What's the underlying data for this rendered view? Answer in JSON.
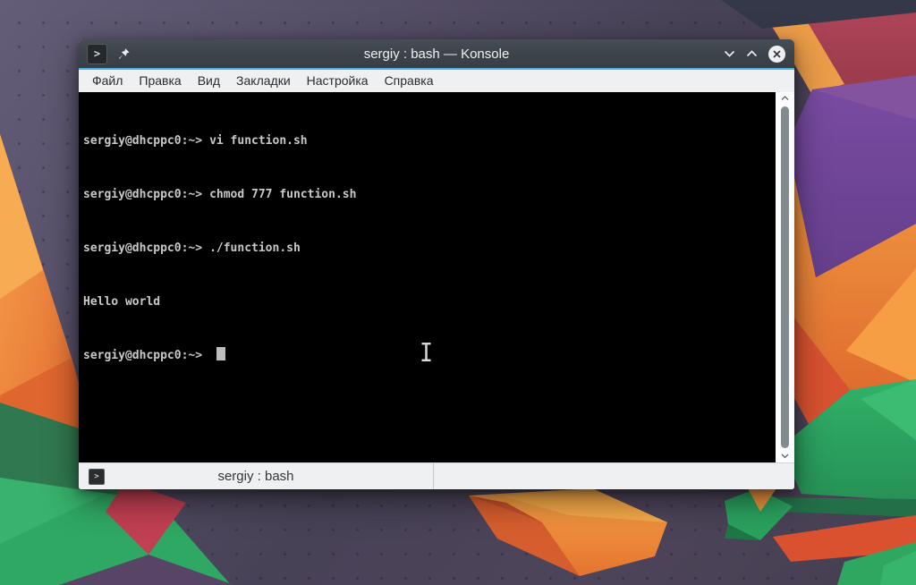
{
  "window": {
    "title": "sergiy : bash — Konsole",
    "menubar": {
      "items": [
        "Файл",
        "Правка",
        "Вид",
        "Закладки",
        "Настройка",
        "Справка"
      ]
    },
    "terminal": {
      "lines": [
        {
          "prompt": "sergiy@dhcppc0:~>",
          "command": "vi function.sh"
        },
        {
          "prompt": "sergiy@dhcppc0:~>",
          "command": "chmod 777 function.sh"
        },
        {
          "prompt": "sergiy@dhcppc0:~>",
          "command": "./function.sh"
        },
        {
          "output": "Hello world"
        },
        {
          "prompt": "sergiy@dhcppc0:~>",
          "command": ""
        }
      ]
    },
    "tabbar": {
      "tabs": [
        {
          "label": "sergiy : bash"
        }
      ]
    }
  },
  "icons": {
    "konsole_glyph": ">"
  },
  "colors": {
    "accent_line": "#4db3e4",
    "titlebar": "#3d434a",
    "menubar_bg": "#eff0f1",
    "terminal_bg": "#000000",
    "terminal_fg": "#c9c9c9",
    "cursor_block": "#bdbdbd",
    "wallpaper_orange": "#ee8b3b",
    "wallpaper_green": "#2fa863",
    "wallpaper_purple": "#6f4494",
    "wallpaper_slate": "#4d4459"
  }
}
